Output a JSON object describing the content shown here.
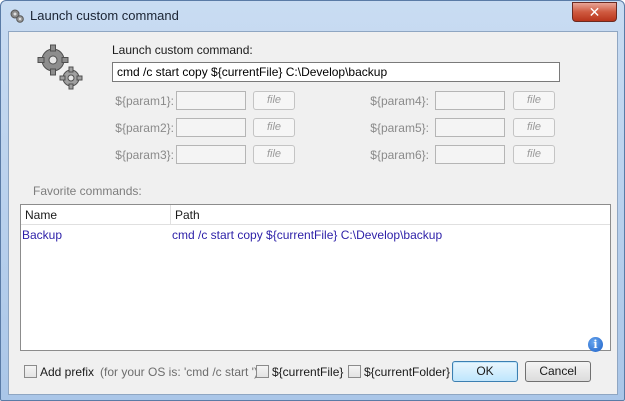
{
  "window": {
    "title": "Launch custom command",
    "close_glyph": "✕"
  },
  "icons": {
    "title": "gears-icon",
    "main": "gears-icon",
    "info": "info-icon"
  },
  "command": {
    "label": "Launch custom command:",
    "value": "cmd /c start copy ${currentFile} C:\\Develop\\backup"
  },
  "params": [
    {
      "label": "${param1}:",
      "value": "",
      "file_label": "file"
    },
    {
      "label": "${param2}:",
      "value": "",
      "file_label": "file"
    },
    {
      "label": "${param3}:",
      "value": "",
      "file_label": "file"
    },
    {
      "label": "${param4}:",
      "value": "",
      "file_label": "file"
    },
    {
      "label": "${param5}:",
      "value": "",
      "file_label": "file"
    },
    {
      "label": "${param6}:",
      "value": "",
      "file_label": "file"
    }
  ],
  "favorites": {
    "label": "Favorite commands:",
    "columns": [
      "Name",
      "Path"
    ],
    "rows": [
      {
        "name": "Backup",
        "path": "cmd /c start copy ${currentFile} C:\\Develop\\backup"
      }
    ]
  },
  "bottom": {
    "add_prefix_label": "Add prefix",
    "prefix_hint": "(for your OS is: 'cmd /c start ')",
    "current_file_label": "${currentFile}",
    "current_folder_label": "${currentFolder}",
    "ok_label": "OK",
    "cancel_label": "Cancel",
    "info_glyph": "i"
  },
  "colors": {
    "accent_text": "#2c1fa8",
    "close_button": "#c84a30"
  }
}
